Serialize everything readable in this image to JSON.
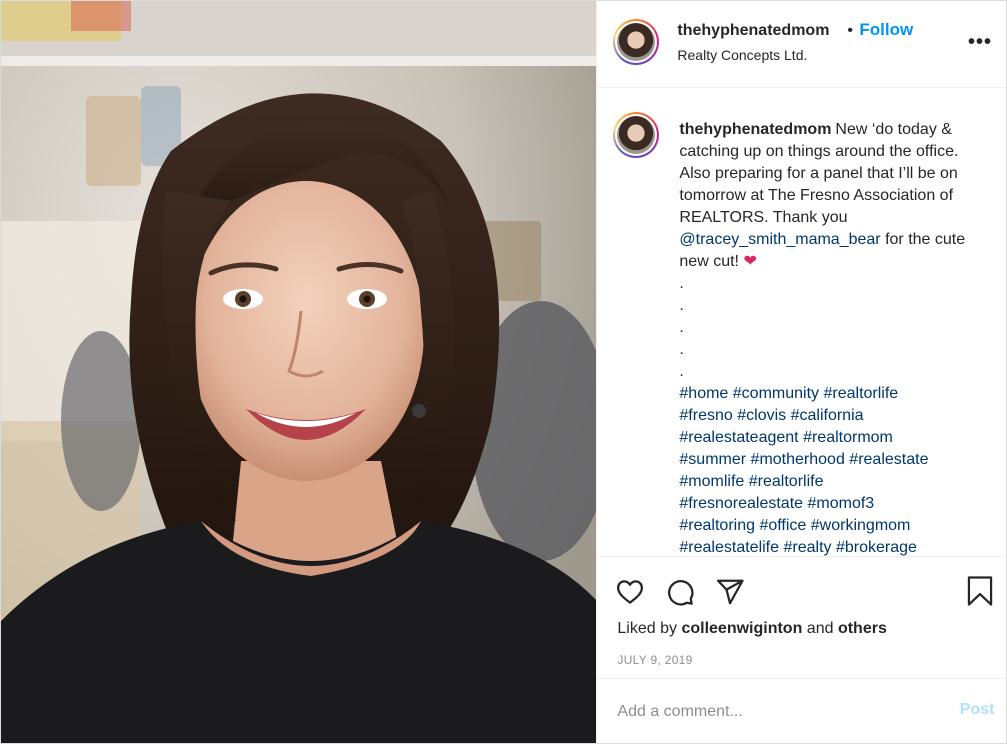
{
  "header": {
    "username": "thehyphenatedmom",
    "dot": "•",
    "follow_label": "Follow",
    "location": "Realty Concepts Ltd.",
    "more_label": "•••"
  },
  "caption": {
    "username": "thehyphenatedmom",
    "text_1": "New ‘do today & catching up on things around the office. Also preparing for a panel that I’ll be on tomorrow at The Fresno Association of REALTORS. Thank you ",
    "mention": "@tracey_smith_mama_bear",
    "text_2": " for the cute new cut! ",
    "emoji": "❤",
    "dots": ".\n.\n.\n.\n.",
    "hashtags": [
      [
        "#home",
        "#community",
        "#realtorlife"
      ],
      [
        "#fresno",
        "#clovis",
        "#california"
      ],
      [
        "#realestateagent",
        "#realtormom"
      ],
      [
        "#summer",
        "#motherhood",
        "#realestate"
      ],
      [
        "#momlife",
        "#realtorlife"
      ],
      [
        "#fresnorealestate",
        "#momof3"
      ],
      [
        "#realtoring",
        "#office",
        "#workingmom"
      ],
      [
        "#realestatelife",
        "#realty",
        "#brokerage"
      ]
    ]
  },
  "actions": {
    "like_icon": "heart-outline-icon",
    "comment_icon": "comment-bubble-icon",
    "share_icon": "paper-plane-icon",
    "save_icon": "bookmark-icon"
  },
  "likes": {
    "prefix": "Liked by ",
    "user": "colleenwiginton",
    "middle": " and ",
    "others": "others"
  },
  "date": "JULY 9, 2019",
  "comment": {
    "placeholder": "Add a comment...",
    "post_label": "Post"
  },
  "colors": {
    "follow": "#0095f6",
    "link": "#00376b",
    "post_disabled": "#b2dffc",
    "muted": "#8e8e8e"
  }
}
